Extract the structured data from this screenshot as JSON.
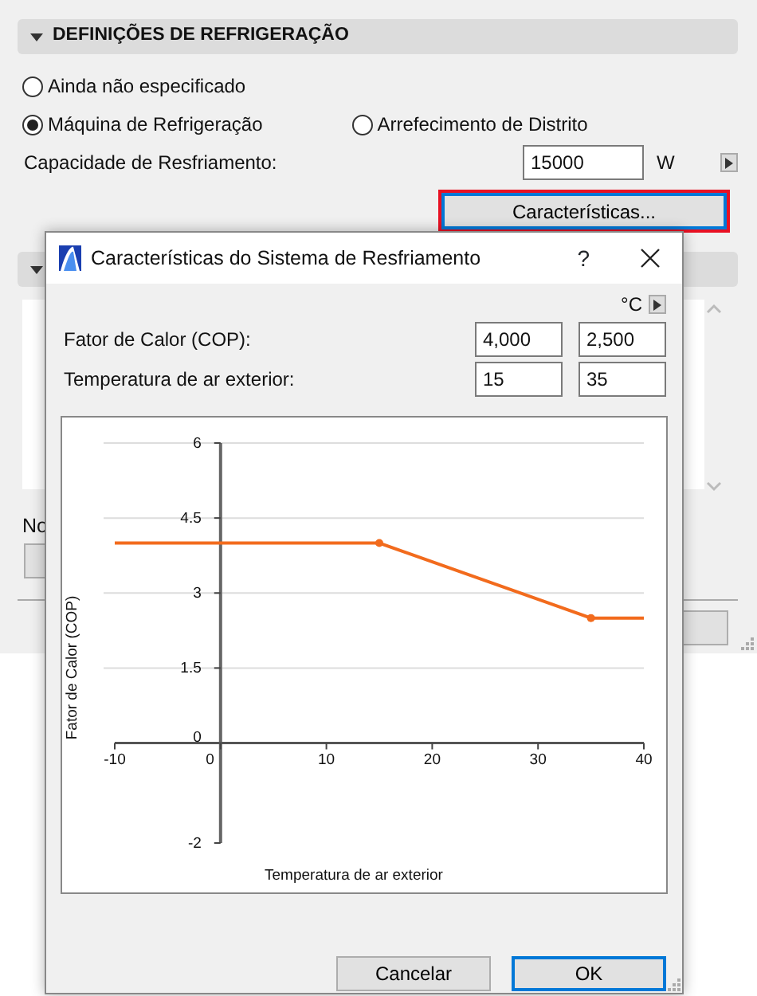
{
  "panel": {
    "section_title": "DEFINIÇÕES DE REFRIGERAÇÃO",
    "expanded": true,
    "radio_rows": [
      [
        {
          "label": "Ainda não especificado",
          "selected": false
        }
      ],
      [
        {
          "label": "Máquina de Refrigeração",
          "selected": true
        },
        {
          "label": "Arrefecimento de Distrito",
          "selected": false
        }
      ]
    ],
    "capacity": {
      "label": "Capacidade de Resfriamento:",
      "value": "15000",
      "unit": "W"
    },
    "characteristics_button": "Características...",
    "partial_label": "No"
  },
  "dialog": {
    "title": "Características do Sistema de Resfriamento",
    "help": "?",
    "unit": "°C",
    "rows": [
      {
        "label": "Fator de Calor (COP):",
        "values": [
          "4,000",
          "2,500"
        ]
      },
      {
        "label": "Temperatura de ar exterior:",
        "values": [
          "15",
          "35"
        ]
      }
    ],
    "chart_data": {
      "type": "line",
      "xlabel": "Temperatura de ar exterior",
      "ylabel": "Fator de Calor (COP)",
      "x": [
        -10,
        15,
        35,
        40
      ],
      "series": [
        {
          "color": "#f26b1d",
          "values": [
            4,
            4,
            2.5,
            2.5
          ]
        }
      ],
      "xlim": [
        -10,
        40
      ],
      "ylim": [
        -2,
        6
      ],
      "xticks": [
        -10,
        0,
        10,
        20,
        30,
        40
      ],
      "yticks": [
        -2,
        0,
        1.5,
        3,
        4.5,
        6
      ],
      "grid": true
    },
    "buttons": [
      {
        "label": "Cancelar",
        "default": false
      },
      {
        "label": "OK",
        "default": true
      }
    ]
  }
}
